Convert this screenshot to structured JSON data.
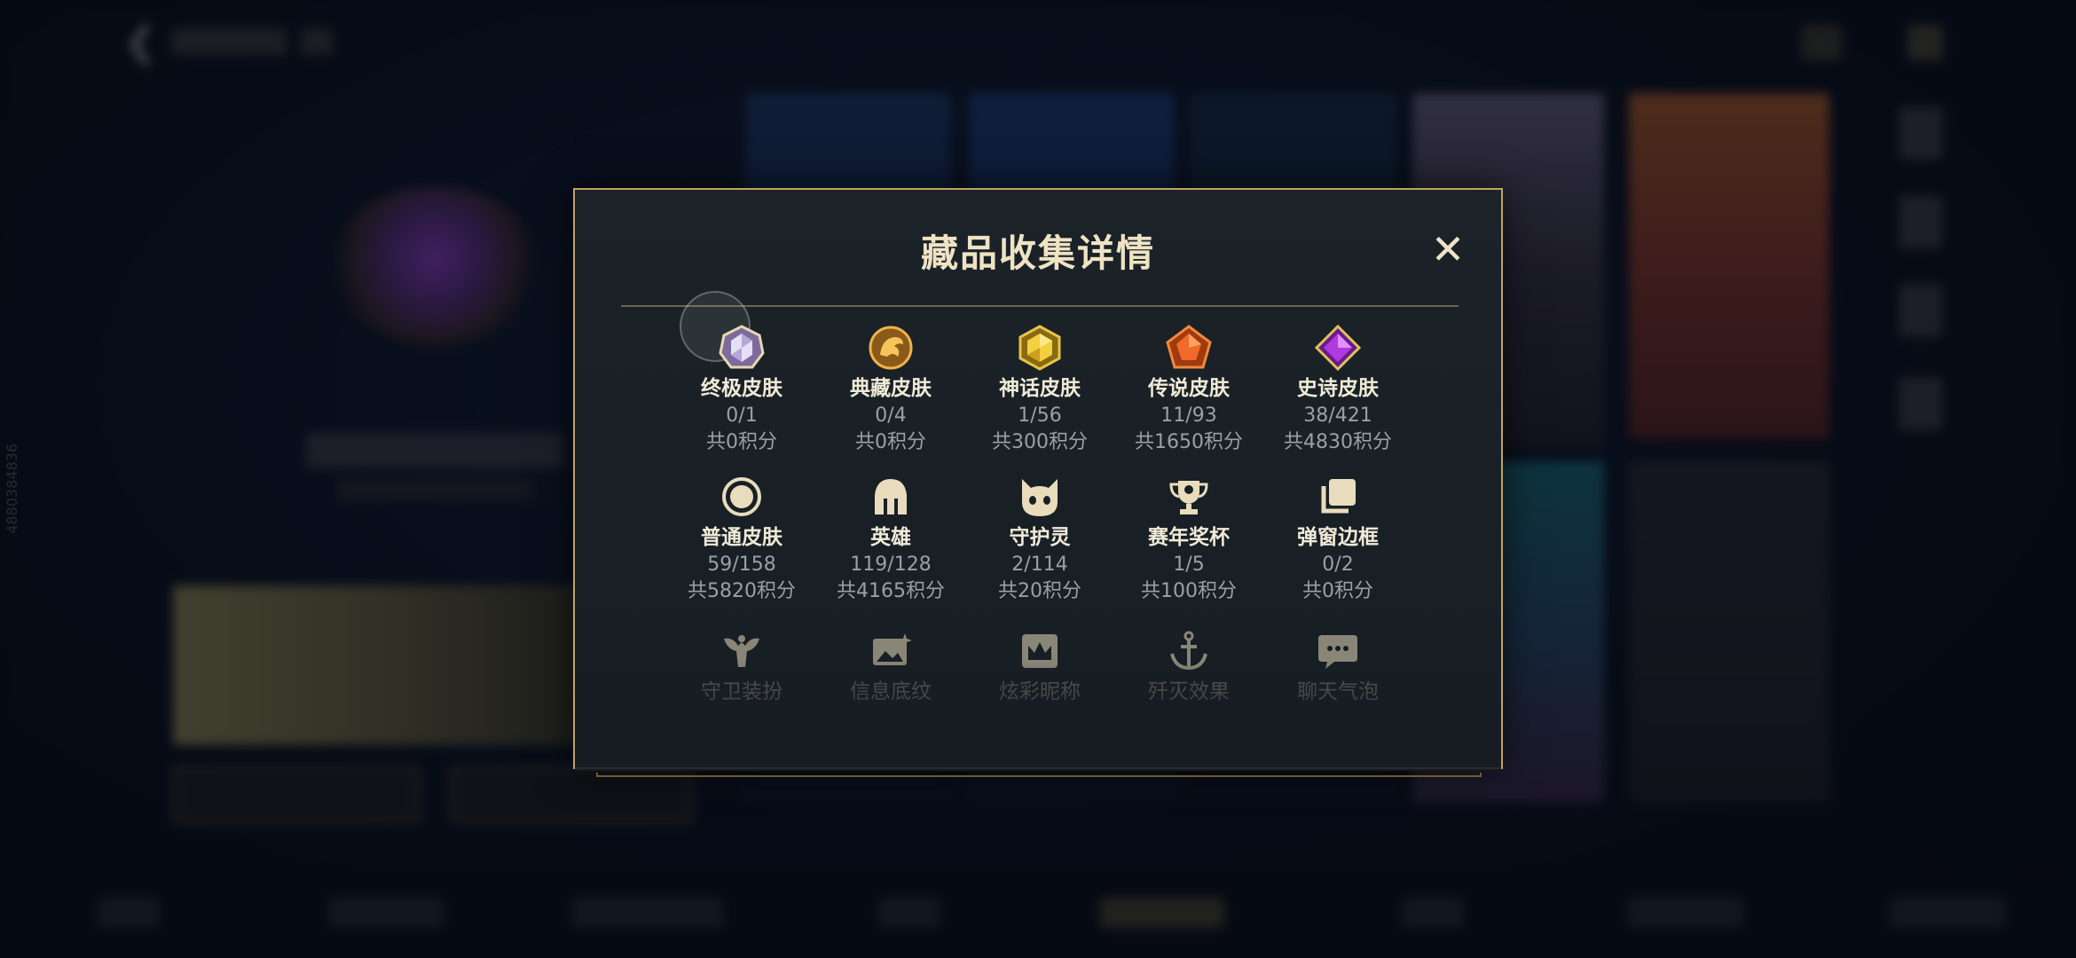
{
  "background": {
    "side_id": "4880384836"
  },
  "modal": {
    "title": "藏品收集详情",
    "close_label": "✕",
    "items": [
      {
        "label": "终极皮肤",
        "count": "0/1",
        "points": "共0积分",
        "icon": "ultimate-skin-gem-icon"
      },
      {
        "label": "典藏皮肤",
        "count": "0/4",
        "points": "共0积分",
        "icon": "prestige-skin-dragon-icon"
      },
      {
        "label": "神话皮肤",
        "count": "1/56",
        "points": "共300积分",
        "icon": "mythic-skin-gem-icon"
      },
      {
        "label": "传说皮肤",
        "count": "11/93",
        "points": "共1650积分",
        "icon": "legendary-skin-gem-icon"
      },
      {
        "label": "史诗皮肤",
        "count": "38/421",
        "points": "共4830积分",
        "icon": "epic-skin-gem-icon"
      },
      {
        "label": "普通皮肤",
        "count": "59/158",
        "points": "共5820积分",
        "icon": "normal-skin-ring-icon"
      },
      {
        "label": "英雄",
        "count": "119/128",
        "points": "共4165积分",
        "icon": "champion-helmet-icon"
      },
      {
        "label": "守护灵",
        "count": "2/114",
        "points": "共20积分",
        "icon": "guardian-spirit-icon"
      },
      {
        "label": "赛年奖杯",
        "count": "1/5",
        "points": "共100积分",
        "icon": "trophy-icon"
      },
      {
        "label": "弹窗边框",
        "count": "0/2",
        "points": "共0积分",
        "icon": "popup-frame-icon"
      },
      {
        "label": "守卫装扮",
        "icon": "ward-skin-icon"
      },
      {
        "label": "信息底纹",
        "icon": "info-card-icon"
      },
      {
        "label": "炫彩昵称",
        "icon": "colorful-nickname-icon"
      },
      {
        "label": "歼灭效果",
        "icon": "anchor-effect-icon"
      },
      {
        "label": "聊天气泡",
        "icon": "chat-bubble-icon"
      }
    ]
  },
  "colors": {
    "gold_border": "#c3a35c",
    "title_text": "#efe3c4",
    "label_text": "#f0ead8",
    "muted_text": "#9aa0a4"
  }
}
